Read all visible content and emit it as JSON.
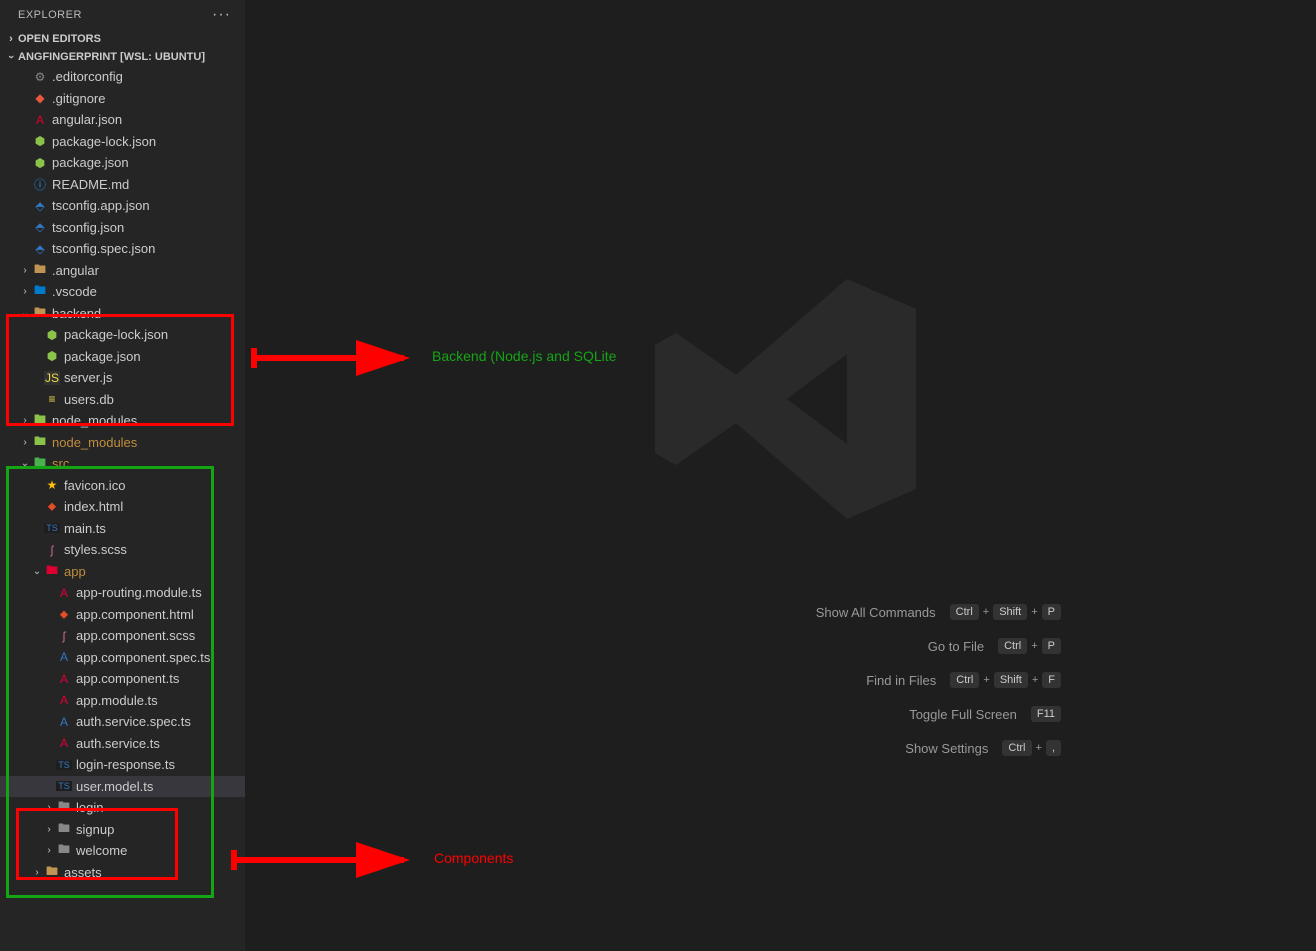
{
  "explorer": {
    "title": "EXPLORER",
    "open_editors": "OPEN EDITORS",
    "workspace": "ANGFINGERPRINT [WSL: UBUNTU]"
  },
  "annotations": {
    "backend": "Backend (Node.js and SQLite",
    "components": "Components"
  },
  "shortcuts": [
    {
      "label": "Show All Commands",
      "keys": [
        "Ctrl",
        "+",
        "Shift",
        "+",
        "P"
      ]
    },
    {
      "label": "Go to File",
      "keys": [
        "Ctrl",
        "+",
        "P"
      ]
    },
    {
      "label": "Find in Files",
      "keys": [
        "Ctrl",
        "+",
        "Shift",
        "+",
        "F"
      ]
    },
    {
      "label": "Toggle Full Screen",
      "keys": [
        "F11"
      ]
    },
    {
      "label": "Show Settings",
      "keys": [
        "Ctrl",
        "+",
        ","
      ]
    }
  ],
  "tree": [
    {
      "d": 1,
      "t": "f",
      "i": "gear",
      "n": ".editorconfig"
    },
    {
      "d": 1,
      "t": "f",
      "i": "git",
      "n": ".gitignore"
    },
    {
      "d": 1,
      "t": "f",
      "i": "ang",
      "n": "angular.json"
    },
    {
      "d": 1,
      "t": "f",
      "i": "npm",
      "n": "package-lock.json"
    },
    {
      "d": 1,
      "t": "f",
      "i": "npm",
      "n": "package.json"
    },
    {
      "d": 1,
      "t": "f",
      "i": "info",
      "n": "README.md"
    },
    {
      "d": 1,
      "t": "f",
      "i": "tscfg",
      "n": "tsconfig.app.json"
    },
    {
      "d": 1,
      "t": "f",
      "i": "tscfg",
      "n": "tsconfig.json"
    },
    {
      "d": 1,
      "t": "f",
      "i": "tscfg",
      "n": "tsconfig.spec.json"
    },
    {
      "d": 1,
      "t": "d",
      "s": "closed",
      "i": "fold",
      "n": ".angular"
    },
    {
      "d": 1,
      "t": "d",
      "s": "closed",
      "i": "vscode",
      "n": ".vscode"
    },
    {
      "d": 1,
      "t": "d",
      "s": "open",
      "i": "foldo",
      "n": "backend"
    },
    {
      "d": 2,
      "t": "f",
      "i": "npm",
      "n": "package-lock.json"
    },
    {
      "d": 2,
      "t": "f",
      "i": "npm",
      "n": "package.json"
    },
    {
      "d": 2,
      "t": "f",
      "i": "js",
      "n": "server.js"
    },
    {
      "d": 2,
      "t": "f",
      "i": "db",
      "n": "users.db"
    },
    {
      "d": 1,
      "t": "d",
      "s": "closed",
      "i": "nm",
      "n": "node_modules"
    },
    {
      "d": 1,
      "t": "d",
      "s": "closed",
      "i": "nm",
      "n": "node_modules",
      "git": "m"
    },
    {
      "d": 1,
      "t": "d",
      "s": "open",
      "i": "src",
      "n": "src",
      "git": "m"
    },
    {
      "d": 2,
      "t": "f",
      "i": "star",
      "n": "favicon.ico"
    },
    {
      "d": 2,
      "t": "f",
      "i": "html",
      "n": "index.html"
    },
    {
      "d": 2,
      "t": "f",
      "i": "ts",
      "n": "main.ts"
    },
    {
      "d": 2,
      "t": "f",
      "i": "scss",
      "n": "styles.scss"
    },
    {
      "d": 2,
      "t": "d",
      "s": "open",
      "i": "app",
      "n": "app",
      "git": "m"
    },
    {
      "d": 3,
      "t": "f",
      "i": "angts",
      "n": "app-routing.module.ts"
    },
    {
      "d": 3,
      "t": "f",
      "i": "html",
      "n": "app.component.html"
    },
    {
      "d": 3,
      "t": "f",
      "i": "scss",
      "n": "app.component.scss"
    },
    {
      "d": 3,
      "t": "f",
      "i": "test",
      "n": "app.component.spec.ts"
    },
    {
      "d": 3,
      "t": "f",
      "i": "angts",
      "n": "app.component.ts"
    },
    {
      "d": 3,
      "t": "f",
      "i": "angts",
      "n": "app.module.ts"
    },
    {
      "d": 3,
      "t": "f",
      "i": "test",
      "n": "auth.service.spec.ts"
    },
    {
      "d": 3,
      "t": "f",
      "i": "angts",
      "n": "auth.service.ts"
    },
    {
      "d": 3,
      "t": "f",
      "i": "ts",
      "n": "login-response.ts"
    },
    {
      "d": 3,
      "t": "f",
      "i": "ts",
      "n": "user.model.ts",
      "sel": true
    },
    {
      "d": 3,
      "t": "d",
      "s": "closed",
      "i": "fgray",
      "n": "login"
    },
    {
      "d": 3,
      "t": "d",
      "s": "closed",
      "i": "fgray",
      "n": "signup"
    },
    {
      "d": 3,
      "t": "d",
      "s": "closed",
      "i": "fgray",
      "n": "welcome"
    },
    {
      "d": 2,
      "t": "d",
      "s": "closed",
      "i": "fold",
      "n": "assets"
    }
  ]
}
